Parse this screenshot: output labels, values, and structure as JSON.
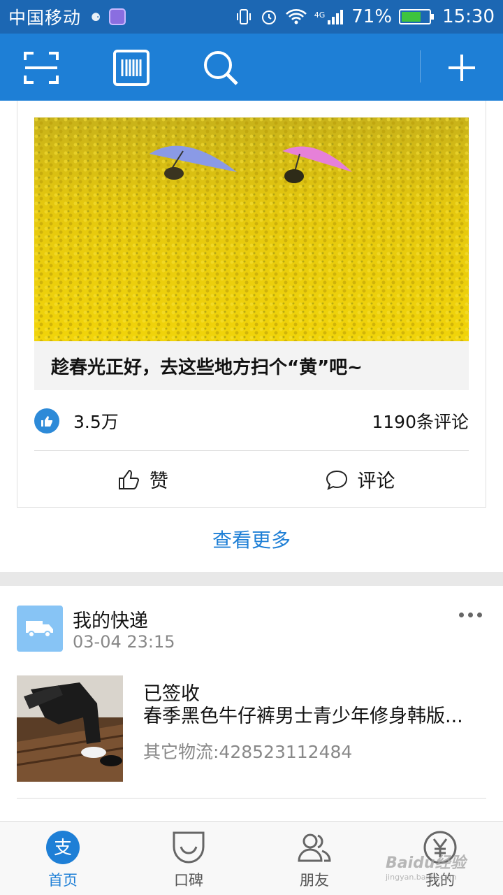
{
  "status_bar": {
    "carrier": "中国移动",
    "network": "4G",
    "battery": "71%",
    "battery_level": 0.71,
    "time": "15:30"
  },
  "toolbar": {
    "icons": [
      "scan-icon",
      "barcode-icon",
      "search-icon",
      "plus-icon"
    ]
  },
  "feed_card": {
    "caption": "趁春光正好，去这些地方扫个“黄”吧~",
    "likes": "3.5万",
    "comments": "1190条评论",
    "like_action": "赞",
    "comment_action": "评论"
  },
  "see_more": "查看更多",
  "express": {
    "title": "我的快递",
    "time": "03-04 23:15",
    "status": "已签收",
    "item": "春季黑色牛仔裤男士青少年修身韩版...",
    "tracking": "其它物流:428523112484"
  },
  "tabs": [
    {
      "label": "首页",
      "icon": "alipay-icon",
      "active": true
    },
    {
      "label": "口碑",
      "icon": "koubei-icon",
      "active": false
    },
    {
      "label": "朋友",
      "icon": "friends-icon",
      "active": false
    },
    {
      "label": "我的",
      "icon": "yen-icon",
      "active": false
    }
  ],
  "watermark": {
    "text": "Baidu经验",
    "sub": "jingyan.baidu.com"
  },
  "colors": {
    "status_bar": "#1c67b3",
    "toolbar": "#1e7fd6",
    "accent": "#1e7fd6",
    "like_badge": "#2d8ad8"
  }
}
